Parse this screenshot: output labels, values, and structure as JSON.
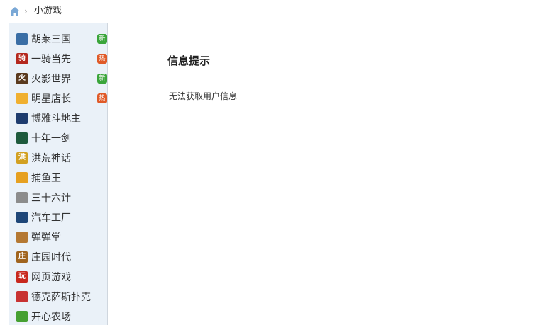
{
  "breadcrumb": {
    "current": "小游戏"
  },
  "sidebar": {
    "items": [
      {
        "label": "胡莱三国",
        "icon": "hulai-game-icon",
        "icon_color": "#3a6ea5",
        "icon_glyph": "",
        "badge": "新",
        "badge_color": "#3aa53a"
      },
      {
        "label": "一骑当先",
        "icon": "yiqi-game-icon",
        "icon_color": "#b4281e",
        "icon_glyph": "骑",
        "badge": "热",
        "badge_color": "#e05a28"
      },
      {
        "label": "火影世界",
        "icon": "huoying-game-icon",
        "icon_color": "#5a3a1e",
        "icon_glyph": "火",
        "badge": "新",
        "badge_color": "#3aa53a"
      },
      {
        "label": "明星店长",
        "icon": "shopping-bag-icon",
        "icon_color": "#f0b030",
        "icon_glyph": "",
        "badge": "热",
        "badge_color": "#e05a28"
      },
      {
        "label": "博雅斗地主",
        "icon": "doudizhu-game-icon",
        "icon_color": "#1e3c6e",
        "icon_glyph": "",
        "badge": "",
        "badge_color": ""
      },
      {
        "label": "十年一剑",
        "icon": "sword-game-icon",
        "icon_color": "#1e5a3c",
        "icon_glyph": "",
        "badge": "",
        "badge_color": ""
      },
      {
        "label": "洪荒神话",
        "icon": "honghuang-game-icon",
        "icon_color": "#d2a020",
        "icon_glyph": "洪",
        "badge": "",
        "badge_color": ""
      },
      {
        "label": "捕鱼王",
        "icon": "fish-game-icon",
        "icon_color": "#e6a020",
        "icon_glyph": "",
        "badge": "",
        "badge_color": ""
      },
      {
        "label": "三十六计",
        "icon": "sanshiliuji-game-icon",
        "icon_color": "#8c8c8c",
        "icon_glyph": "",
        "badge": "",
        "badge_color": ""
      },
      {
        "label": "汽车工厂",
        "icon": "car-factory-game-icon",
        "icon_color": "#1e4678",
        "icon_glyph": "",
        "badge": "",
        "badge_color": ""
      },
      {
        "label": "弹弹堂",
        "icon": "dandantang-game-icon",
        "icon_color": "#b47832",
        "icon_glyph": "",
        "badge": "",
        "badge_color": ""
      },
      {
        "label": "庄园时代",
        "icon": "zhuangyuan-game-icon",
        "icon_color": "#a0641e",
        "icon_glyph": "庄",
        "badge": "",
        "badge_color": ""
      },
      {
        "label": "网页游戏",
        "icon": "web-game-icon",
        "icon_color": "#c8281e",
        "icon_glyph": "玩",
        "badge": "",
        "badge_color": ""
      },
      {
        "label": "德克萨斯扑克",
        "icon": "poker-game-icon",
        "icon_color": "#c83232",
        "icon_glyph": "",
        "badge": "",
        "badge_color": ""
      },
      {
        "label": "开心农场",
        "icon": "sprout-icon",
        "icon_color": "#46a032",
        "icon_glyph": "",
        "badge": "",
        "badge_color": ""
      }
    ]
  },
  "main": {
    "title": "信息提示",
    "message": "无法获取用户信息"
  }
}
